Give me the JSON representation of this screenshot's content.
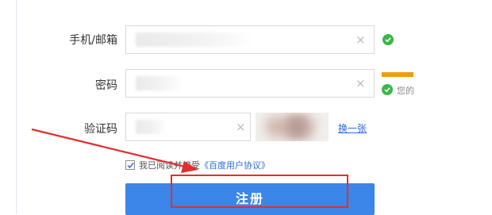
{
  "form": {
    "phone_email": {
      "label": "手机/邮箱",
      "value": "",
      "clear_icon": "×"
    },
    "password": {
      "label": "密码",
      "value": "",
      "clear_icon": "×",
      "hint": "您的"
    },
    "captcha": {
      "label": "验证码",
      "value": "",
      "clear_icon": "×",
      "refresh_label": "换一张"
    },
    "agreement": {
      "text": "我已阅读并接受",
      "link_text": "《百度用户协议》",
      "checked": true
    },
    "submit_label": "注册"
  },
  "colors": {
    "accent": "#3b86e8",
    "success": "#3bb64a",
    "strength_bar": "#f29c10",
    "annotation": "#e03030",
    "link": "#2a6bd7"
  },
  "annotations": {
    "arrow_color": "#e03030",
    "highlight_color": "#e03030"
  }
}
